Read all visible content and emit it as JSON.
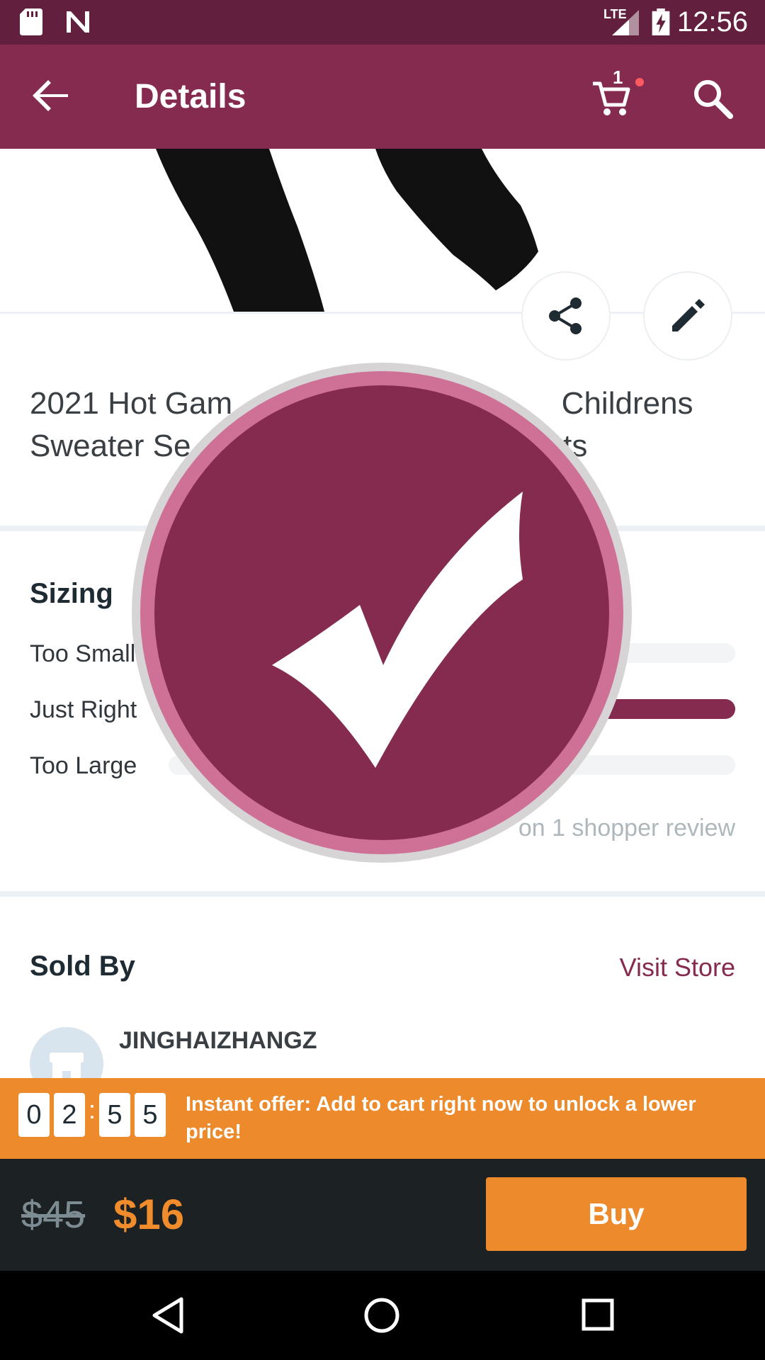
{
  "status_bar": {
    "time": "12:56",
    "network": "LTE",
    "icons": [
      "sd-card-icon",
      "n-notification-icon",
      "signal-icon",
      "battery-charging-icon"
    ]
  },
  "app_bar": {
    "title": "Details",
    "cart_count": "1",
    "icons": [
      "back-arrow-icon",
      "cart-icon",
      "search-icon"
    ]
  },
  "product": {
    "title": "2021 Hot Gam                                      Childrens Sweater Se                                         nts",
    "action_icons": [
      "share-icon",
      "edit-icon"
    ]
  },
  "sizing": {
    "heading": "Sizing",
    "rows": [
      {
        "label": "Too Small",
        "fraction": 0.0
      },
      {
        "label": "Just Right",
        "fraction": 1.0
      },
      {
        "label": "Too Large",
        "fraction": 0.0
      }
    ],
    "review_note": "on 1 shopper review"
  },
  "seller": {
    "heading": "Sold By",
    "visit_store_label": "Visit Store",
    "store_name": "JINGHAIZHANGZ",
    "avatar_icon": "store-icon"
  },
  "offer": {
    "timer_digits": [
      "0",
      "2",
      "5",
      "5"
    ],
    "separator": ":",
    "text": "Instant offer: Add to cart right now to unlock a lower price!"
  },
  "buy_bar": {
    "old_price": "$45",
    "new_price": "$16",
    "buy_label": "Buy"
  },
  "overlay": {
    "icon": "checkmark-icon"
  },
  "colors": {
    "brand": "#862b50",
    "status_bar": "#63203e",
    "offer": "#ec8a2c",
    "buy_bar": "#1c2124"
  }
}
